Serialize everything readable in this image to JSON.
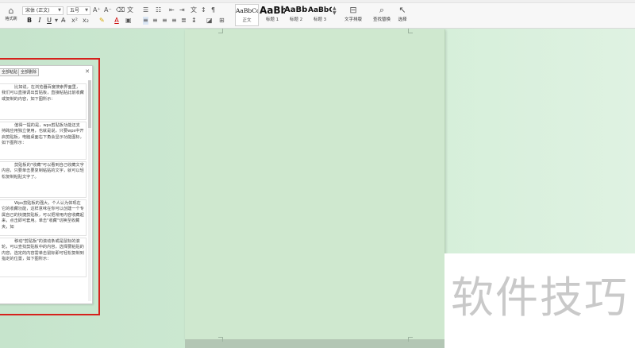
{
  "ribbon": {
    "format_painter_label": "格式刷",
    "font_name": "宋体 (正文)",
    "font_size": "五号",
    "format_buttons": [
      "B",
      "I",
      "U",
      "A"
    ],
    "styles": [
      {
        "sample": "AaBbCcI",
        "label": "正文"
      },
      {
        "sample": "AaBb",
        "label": "标题 1"
      },
      {
        "sample": "AaBb(",
        "label": "标题 2"
      },
      {
        "sample": "AaBbC",
        "label": "标题 3"
      }
    ],
    "text_layout_label": "文字排版",
    "find_replace_label": "查找替换",
    "select_label": "选择"
  },
  "clipboard": {
    "paste_all_label": "全部粘贴",
    "clear_all_label": "全部删除",
    "items": [
      "比如说，在浏览器百度搜索界面里，我们可以直接调出剪贴板，直接粘贴此前收藏或复制的内容，如下图所示：",
      "值得一提的是，wps剪贴板功能还支持跨应用独立使用，也就是说，只要wps中开启剪贴板，电脑桌面右下角会显示功能图标，如下图所示：",
      "剪贴板的\"收藏\"可以看到自己收藏文字内容，只要单击要复制粘贴的文字，就可以轻松复制粘贴文字了。",
      "Wps剪贴板的强大，个人认为体现在它的收藏功能，这样意味在你可以创建一个专属自己的快捷剪贴板，可以把常用内容收藏起来，点击即可套用。单击\"收藏\"切换至收藏夹，如",
      "移动\"剪贴板\"的滚动条或是鼠标的滚轮，可以查找剪贴板中的内容，选择要粘贴的内容，选定的内容需单击鼠标即可轻松复制到指定的位置，如下图所示："
    ]
  },
  "watermark": {
    "text": "软件技巧"
  },
  "colors": {
    "eye_care_green": "#cfe8cf",
    "highlight_red": "#d6211c",
    "ribbon_bg": "#f7f7f7"
  }
}
